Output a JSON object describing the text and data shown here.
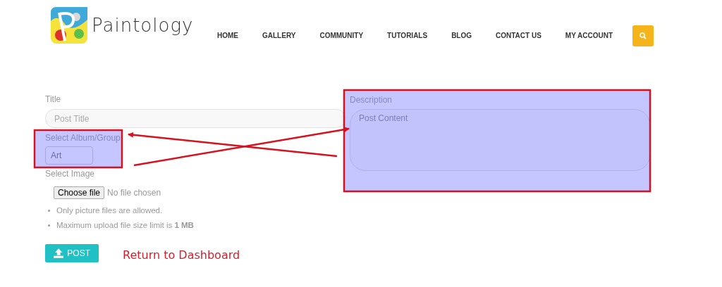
{
  "logo": {
    "text": "Paintology"
  },
  "nav": [
    "HOME",
    "GALLERY",
    "COMMUNITY",
    "TUTORIALS",
    "BLOG",
    "CONTACT US",
    "MY ACCOUNT"
  ],
  "form": {
    "title": {
      "label": "Title",
      "placeholder": "Post Title"
    },
    "album": {
      "label": "Select Album/Group",
      "value": "Art"
    },
    "image": {
      "label": "Select Image",
      "button": "Choose file",
      "status": "No file chosen"
    },
    "notes": [
      "Only picture files are allowed.",
      "Maximum upload file size limit is **1 MB**"
    ],
    "description": {
      "label": "Description",
      "placeholder": "Post Content"
    },
    "post_button": "POST",
    "return_link": "Return to Dashboard"
  }
}
